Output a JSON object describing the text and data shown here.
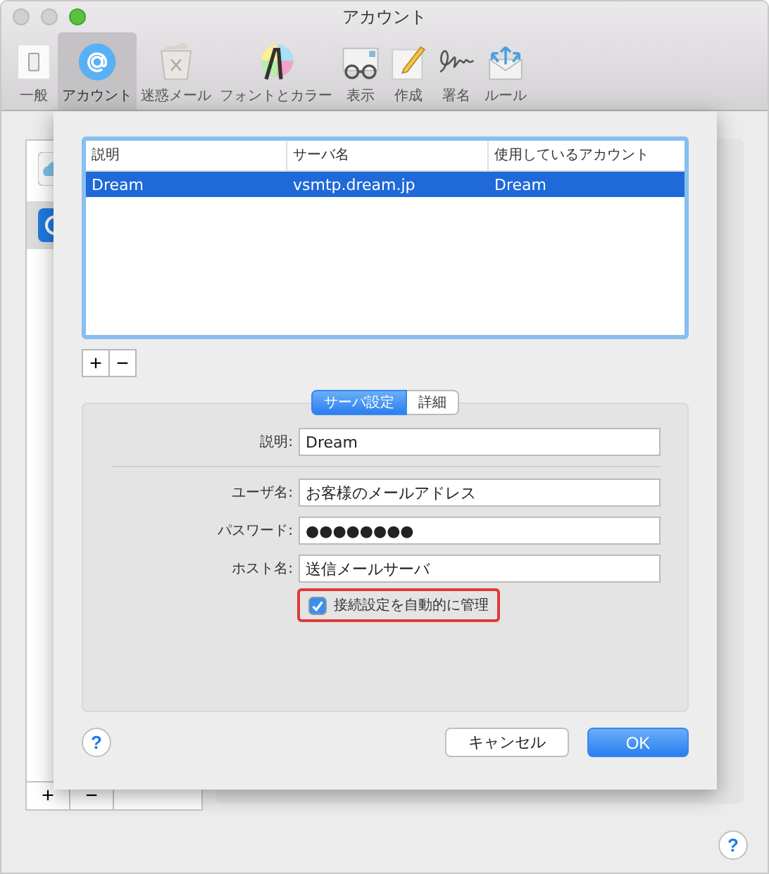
{
  "window": {
    "title": "アカウント"
  },
  "toolbar": [
    {
      "label": "一般",
      "kind": "general",
      "selected": false
    },
    {
      "label": "アカウント",
      "kind": "accounts",
      "selected": true
    },
    {
      "label": "迷惑メール",
      "kind": "junk",
      "selected": false
    },
    {
      "label": "フォントとカラー",
      "kind": "fonts",
      "selected": false
    },
    {
      "label": "表示",
      "kind": "viewing",
      "selected": false
    },
    {
      "label": "作成",
      "kind": "composing",
      "selected": false
    },
    {
      "label": "署名",
      "kind": "signatures",
      "selected": false
    },
    {
      "label": "ルール",
      "kind": "rules",
      "selected": false
    }
  ],
  "sidebar": {
    "items": [
      {
        "kind": "cloud",
        "selected": false
      },
      {
        "kind": "at",
        "selected": true
      }
    ],
    "buttons": [
      "+",
      "−"
    ]
  },
  "sheet": {
    "table": {
      "columns": [
        "説明",
        "サーバ名",
        "使用しているアカウント"
      ],
      "rows": [
        {
          "cells": [
            "Dream",
            "vsmtp.dream.jp",
            "Dream"
          ],
          "selected": true
        }
      ]
    },
    "table_buttons": [
      "+",
      "−"
    ],
    "tabs": [
      {
        "label": "サーバ設定",
        "selected": true
      },
      {
        "label": "詳細",
        "selected": false
      }
    ],
    "field_groups": [
      {
        "fields": [
          {
            "label": "説明:",
            "value": "Dream"
          }
        ]
      },
      {
        "fields": [
          {
            "label": "ユーザ名:",
            "value": "お客様のメールアドレス"
          },
          {
            "label": "パスワード:",
            "value": "●●●●●●●●"
          },
          {
            "label": "ホスト名:",
            "value": "送信メールサーバ"
          }
        ]
      }
    ],
    "checkbox": {
      "label": "接続設定を自動的に管理",
      "checked": true,
      "highlighted": true
    },
    "help": "?",
    "cancel": "キャンセル",
    "ok": "OK"
  },
  "help": "?"
}
